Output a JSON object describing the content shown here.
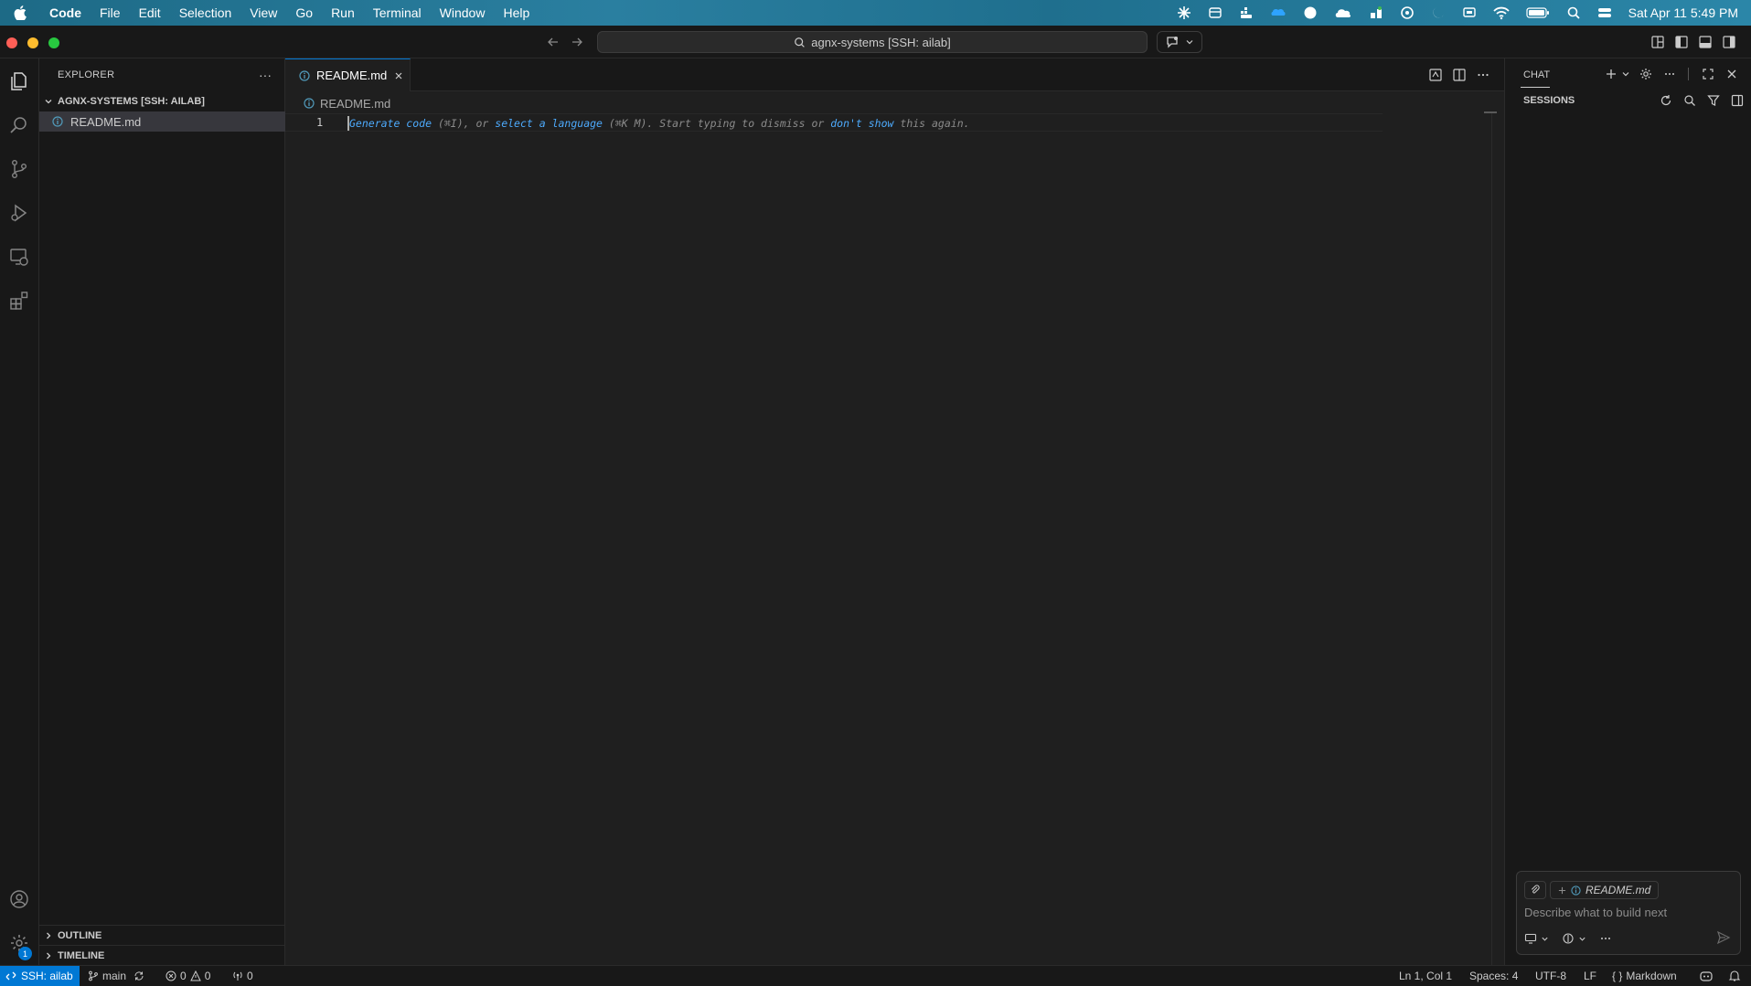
{
  "menubar": {
    "app_name": "Code",
    "items": [
      "File",
      "Edit",
      "Selection",
      "View",
      "Go",
      "Run",
      "Terminal",
      "Window",
      "Help"
    ],
    "clock": "Sat Apr 11  5:49 PM"
  },
  "titlebar": {
    "search_text": "agnx-systems [SSH: ailab]"
  },
  "sidebar": {
    "title": "EXPLORER",
    "more": "···",
    "folder": "AGNX-SYSTEMS [SSH: AILAB]",
    "file": "README.md",
    "outline": "OUTLINE",
    "timeline": "TIMELINE"
  },
  "activity": {
    "settings_badge": "1"
  },
  "editor": {
    "tab_label": "README.md",
    "breadcrumb": "README.md",
    "line_number": "1",
    "hint": {
      "generate": "Generate code",
      "shortcut1": " (⌘I), or ",
      "select": "select a language",
      "shortcut2": " (⌘K M). Start typing to dismiss or ",
      "dont_show": "don't show",
      "tail": " this again."
    }
  },
  "chat": {
    "title": "CHAT",
    "sessions": "SESSIONS",
    "context_file": "README.md",
    "placeholder": "Describe what to build next"
  },
  "statusbar": {
    "remote": "SSH: ailab",
    "branch": "main",
    "errors": "0",
    "warnings": "0",
    "ports": "0",
    "cursor": "Ln 1, Col 1",
    "spaces": "Spaces: 4",
    "encoding": "UTF-8",
    "eol": "LF",
    "language": "Markdown"
  },
  "colors": {
    "accent": "#0078d4",
    "link": "#4daafc",
    "traffic_red": "#ff5f57",
    "traffic_yellow": "#febc2e",
    "traffic_green": "#28c840"
  }
}
